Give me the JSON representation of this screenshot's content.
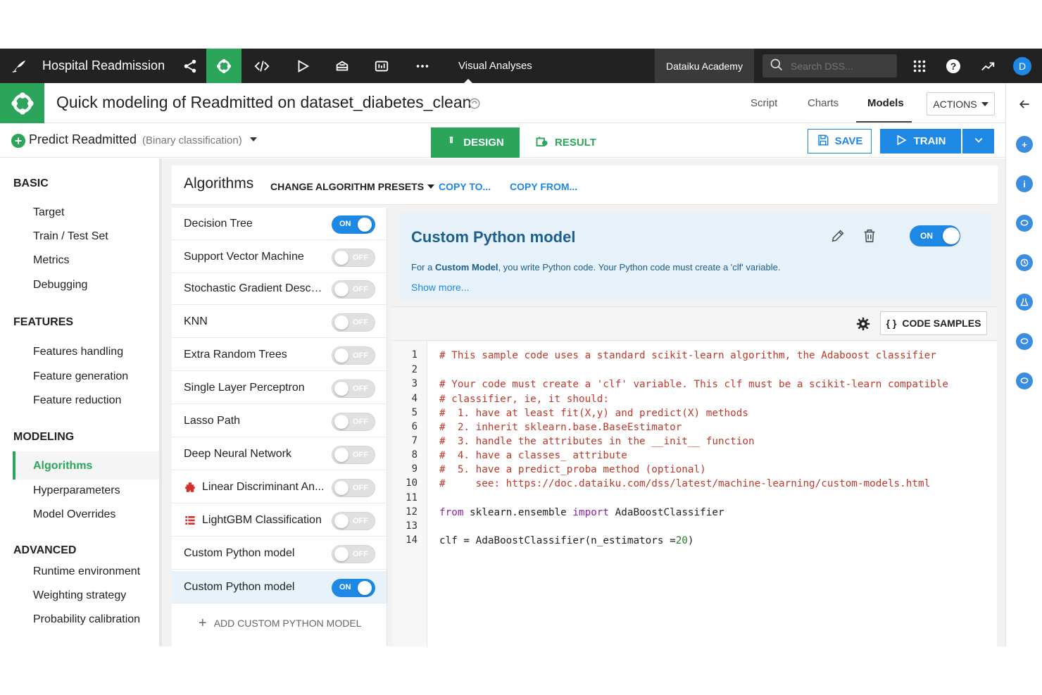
{
  "topbar": {
    "project_title": "Hospital Readmission",
    "section_label": "Visual Analyses",
    "academy_label": "Dataiku Academy",
    "search_placeholder": "Search DSS...",
    "avatar_initial": "D",
    "help_label": "?"
  },
  "header": {
    "analysis_title": "Quick modeling of Readmitted on dataset_diabetes_clean",
    "tabs": [
      "Script",
      "Charts",
      "Models"
    ],
    "active_tab": "Models",
    "actions_label": "ACTIONS"
  },
  "task": {
    "name": "Predict Readmitted",
    "type": "(Binary classification)",
    "design_label": "DESIGN",
    "result_label": "RESULT",
    "save_label": "SAVE",
    "train_label": "TRAIN"
  },
  "nav": {
    "sections": [
      {
        "title": "BASIC",
        "items": [
          "Target",
          "Train / Test Set",
          "Metrics",
          "Debugging"
        ]
      },
      {
        "title": "FEATURES",
        "items": [
          "Features handling",
          "Feature generation",
          "Feature reduction"
        ]
      },
      {
        "title": "MODELING",
        "items": [
          "Algorithms",
          "Hyperparameters",
          "Model Overrides"
        ]
      },
      {
        "title": "ADVANCED",
        "items": [
          "Runtime environment",
          "Weighting strategy",
          "Probability calibration"
        ]
      }
    ],
    "active_item": "Algorithms"
  },
  "algorithms_panel": {
    "title": "Algorithms",
    "change_presets": "CHANGE ALGORITHM PRESETS",
    "copy_to": "COPY TO...",
    "copy_from": "COPY FROM...",
    "add_custom": "ADD CUSTOM PYTHON MODEL",
    "on_label": "ON",
    "off_label": "OFF",
    "items": [
      {
        "label": "Decision Tree",
        "enabled": true,
        "selected": false
      },
      {
        "label": "Support Vector Machine",
        "enabled": false,
        "selected": false
      },
      {
        "label": "Stochastic Gradient Descent",
        "enabled": false,
        "selected": false
      },
      {
        "label": "KNN",
        "enabled": false,
        "selected": false
      },
      {
        "label": "Extra Random Trees",
        "enabled": false,
        "selected": false
      },
      {
        "label": "Single Layer Perceptron",
        "enabled": false,
        "selected": false
      },
      {
        "label": "Lasso Path",
        "enabled": false,
        "selected": false
      },
      {
        "label": "Deep Neural Network",
        "enabled": false,
        "selected": false
      },
      {
        "label": "Linear Discriminant An...",
        "enabled": false,
        "selected": false,
        "icon": "plugin-icon",
        "icon_color": "#d32f2f"
      },
      {
        "label": "LightGBM Classification",
        "enabled": false,
        "selected": false,
        "icon": "list-icon",
        "icon_color": "#d32f2f"
      },
      {
        "label": "Custom Python model",
        "enabled": false,
        "selected": false
      },
      {
        "label": "Custom Python model",
        "enabled": true,
        "selected": true
      }
    ]
  },
  "model_detail": {
    "title": "Custom Python model",
    "desc_prefix": "For a ",
    "desc_bold": "Custom Model",
    "desc_suffix": ", you write Python code. Your Python code must create a 'clf' variable.",
    "show_more": "Show more...",
    "toggle_label": "ON",
    "code_samples_label": "CODE SAMPLES",
    "code_samples_icon": "{ }"
  },
  "code": {
    "lines": [
      "# This sample code uses a standard scikit-learn algorithm, the Adaboost classifier",
      "",
      "# Your code must create a 'clf' variable. This clf must be a scikit-learn compatible",
      "# classifier, ie, it should:",
      "#  1. have at least fit(X,y) and predict(X) methods",
      "#  2. inherit sklearn.base.BaseEstimator",
      "#  3. handle the attributes in the __init__ function",
      "#  4. have a classes_ attribute",
      "#  5. have a predict_proba method (optional)",
      "#     see: https://doc.dataiku.com/dss/latest/machine-learning/custom-models.html",
      "",
      "from sklearn.ensemble import AdaBoostClassifier",
      "",
      "clf = AdaBoostClassifier(n_estimators =20)"
    ],
    "colors": {
      "comment": "#c0392b",
      "keyword": "#8e24aa",
      "number": "#2e7d32"
    }
  },
  "colors": {
    "brand_green": "#2aa55a",
    "accent_blue": "#1e88e5",
    "topbar": "#222222"
  }
}
